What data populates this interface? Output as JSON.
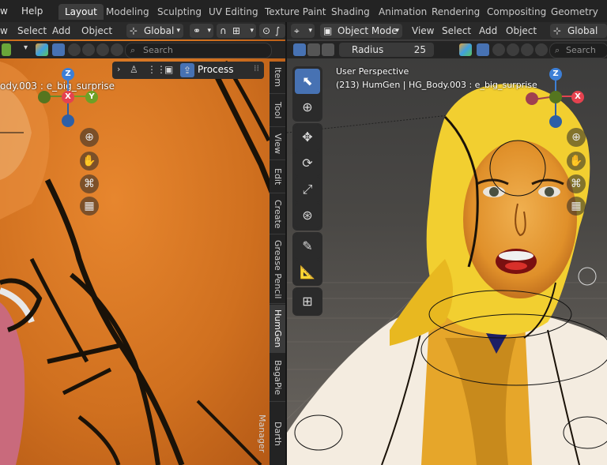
{
  "topbar": {
    "menus": [
      {
        "label": "w"
      },
      {
        "label": "Help"
      }
    ],
    "workspaces": [
      "Layout",
      "Modeling",
      "Sculpting",
      "UV Editing",
      "Texture Paint",
      "Shading",
      "Animation",
      "Rendering",
      "Compositing",
      "Geometry Nod"
    ],
    "active_workspace": "Layout"
  },
  "left": {
    "header": {
      "view": "w",
      "select": "Select",
      "add": "Add",
      "object": "Object",
      "orientation": "Global"
    },
    "search": {
      "placeholder": "Search"
    },
    "process_label": "Process",
    "overlay_text": "ody.003 : e_big_surprise",
    "tabs": [
      "Item",
      "Tool",
      "View",
      "Edit",
      "Create",
      "Grease Pencil",
      "HumGen",
      "BagaPie",
      "Darth Manager"
    ],
    "active_tab": "HumGen",
    "gizmo": {
      "z": "Z",
      "x": "X",
      "y": "Y"
    }
  },
  "right": {
    "header": {
      "mode": "Object Mode",
      "view": "View",
      "select": "Select",
      "add": "Add",
      "object": "Object",
      "orientation": "Global"
    },
    "radius_label": "Radius",
    "radius_value": "25",
    "search": {
      "placeholder": "Search"
    },
    "perspective": "User Perspective",
    "object_info": "(213) HumGen | HG_Body.003 : e_big_surprise",
    "gizmo": {
      "z": "Z",
      "x": "X"
    }
  },
  "colors": {
    "accent": "#4772b3",
    "x_axis": "#e5424f",
    "y_axis": "#6ea026",
    "z_axis": "#3d7fd6"
  }
}
